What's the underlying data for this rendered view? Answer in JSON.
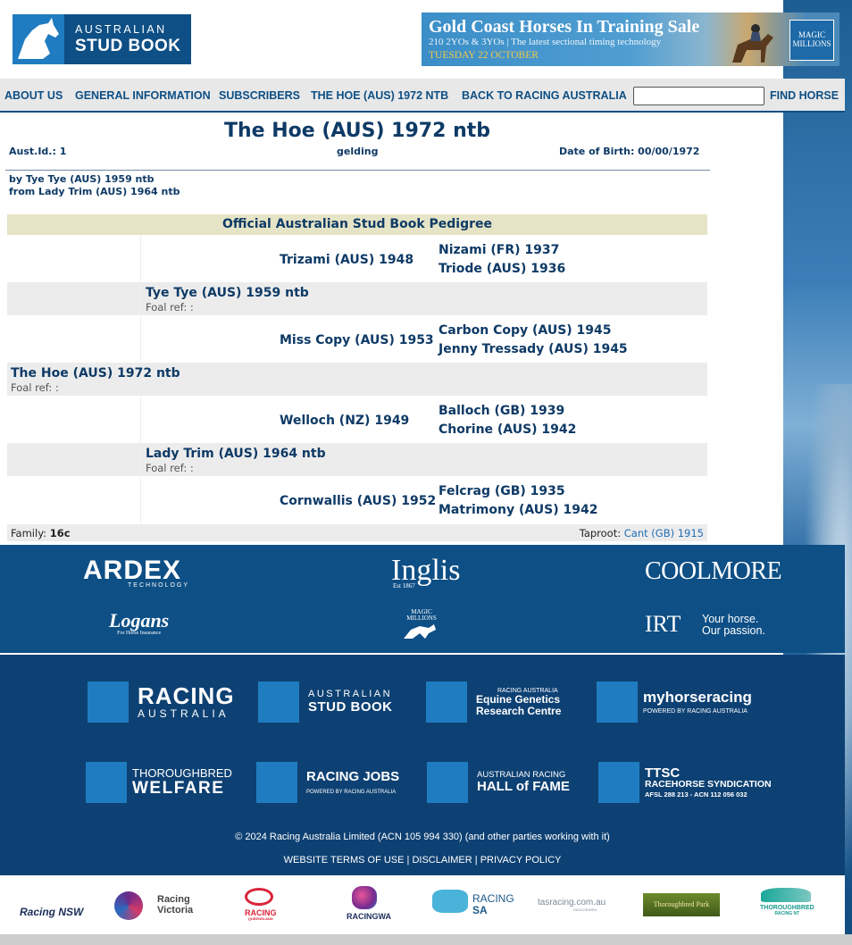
{
  "header": {
    "logo_line1": "AUSTRALIAN",
    "logo_line2": "STUD BOOK",
    "banner_title": "Gold Coast Horses In Training Sale",
    "banner_sub": "210 2YOs & 3YOs | The latest sectional timing technology",
    "banner_date": "TUESDAY 22 OCTOBER",
    "banner_badge_1": "MAGIC",
    "banner_badge_2": "MILLIONS"
  },
  "nav": {
    "about": "ABOUT US",
    "general": "GENERAL INFORMATION",
    "subscribers": "SUBSCRIBERS",
    "current": "THE HOE (AUS) 1972 NTB",
    "back": "BACK TO RACING AUSTRALIA",
    "search_value": "",
    "find": "FIND HORSE"
  },
  "horse": {
    "title": "The Hoe (AUS) 1972 ntb",
    "aust_id": "Aust.Id.: 1",
    "sex": "gelding",
    "dob": "Date of Birth: 00/00/1972",
    "sire_line": "by Tye Tye (AUS) 1959 ntb",
    "dam_line": "from Lady Trim (AUS) 1964 ntb"
  },
  "pedigree": {
    "heading": "Official Australian Stud Book Pedigree",
    "subject": "The Hoe (AUS) 1972 ntb",
    "sire": "Tye Tye (AUS) 1959 ntb",
    "dam": "Lady Trim (AUS) 1964 ntb",
    "foal_ref": "Foal ref: :",
    "ss": "Trizami (AUS) 1948",
    "sd": "Miss Copy (AUS) 1953",
    "ds": "Welloch (NZ) 1949",
    "dd": "Cornwallis (AUS) 1952",
    "sss": "Nizami (FR) 1937",
    "ssd": "Triode (AUS) 1936",
    "sds": "Carbon Copy (AUS) 1945",
    "sdd": "Jenny Tressady (AUS) 1945",
    "dss": "Balloch (GB) 1939",
    "dsd": "Chorine (AUS) 1942",
    "dds": "Felcrag (GB) 1935",
    "ddd": "Matrimony (AUS) 1942",
    "family_label": "Family:",
    "family": "16c",
    "taproot_label": "Taproot:",
    "taproot": "Cant (GB) 1915"
  },
  "sponsors": {
    "ardex": "ARDEX",
    "ardex_sub": "TECHNOLOGY",
    "inglis": "Inglis",
    "inglis_sub": "Est 1867",
    "coolmore": "COOLMORE",
    "logans": "Logans",
    "logans_sub": "For Horse Insurance",
    "magic_1": "MAGIC",
    "magic_2": "MILLIONS",
    "irt": "IRT",
    "irt_tag_1": "Your horse.",
    "irt_tag_2": "Our passion."
  },
  "footer": {
    "racing_australia_1": "RACING",
    "racing_australia_2": "AUSTRALIA",
    "stud_book_1": "AUSTRALIAN",
    "stud_book_2": "STUD BOOK",
    "egrc_1": "RACING AUSTRALIA",
    "egrc_2": "Equine Genetics",
    "egrc_3": "Research Centre",
    "myhorse_1": "myhorseracing",
    "myhorse_2": "POWERED BY RACING AUSTRALIA",
    "welfare_1": "THOROUGHBRED",
    "welfare_2": "WELFARE",
    "jobs_1": "RACING JOBS",
    "jobs_2": "POWERED BY RACING AUSTRALIA",
    "hof_1": "AUSTRALIAN RACING",
    "hof_2": "HALL of FAME",
    "ttsc_1": "TTSC",
    "ttsc_2": "RACEHORSE SYNDICATION",
    "ttsc_3": "AFSL 288 213 - ACN 112 056 032",
    "copyright": "© 2024 Racing Australia Limited (ACN 105 994 330) (and other parties working with it)",
    "terms": "WEBSITE TERMS OF USE",
    "disclaimer": "DISCLAIMER",
    "privacy": "PRIVACY POLICY",
    "sep": "|"
  },
  "states": {
    "nsw": "Racing NSW",
    "vic_1": "Racing",
    "vic_2": "Victoria",
    "qld": "RACING",
    "qld_sub": "QUEENSLAND",
    "wa": "RACINGWA",
    "sa_1": "RACING",
    "sa_2": "SA",
    "tas": "tasracing.com.au",
    "tas_sub": "DATA DRIVEN",
    "tbpark": "Thoroughbred Park",
    "nt_1": "THOROUGHBRED",
    "nt_2": "RACING NT"
  },
  "colors": {
    "brand_dark": "#0e4f85",
    "brand_light": "#1f7cc0",
    "text_navy": "#0e3a66",
    "pedigree_header": "#e6e4c6"
  }
}
